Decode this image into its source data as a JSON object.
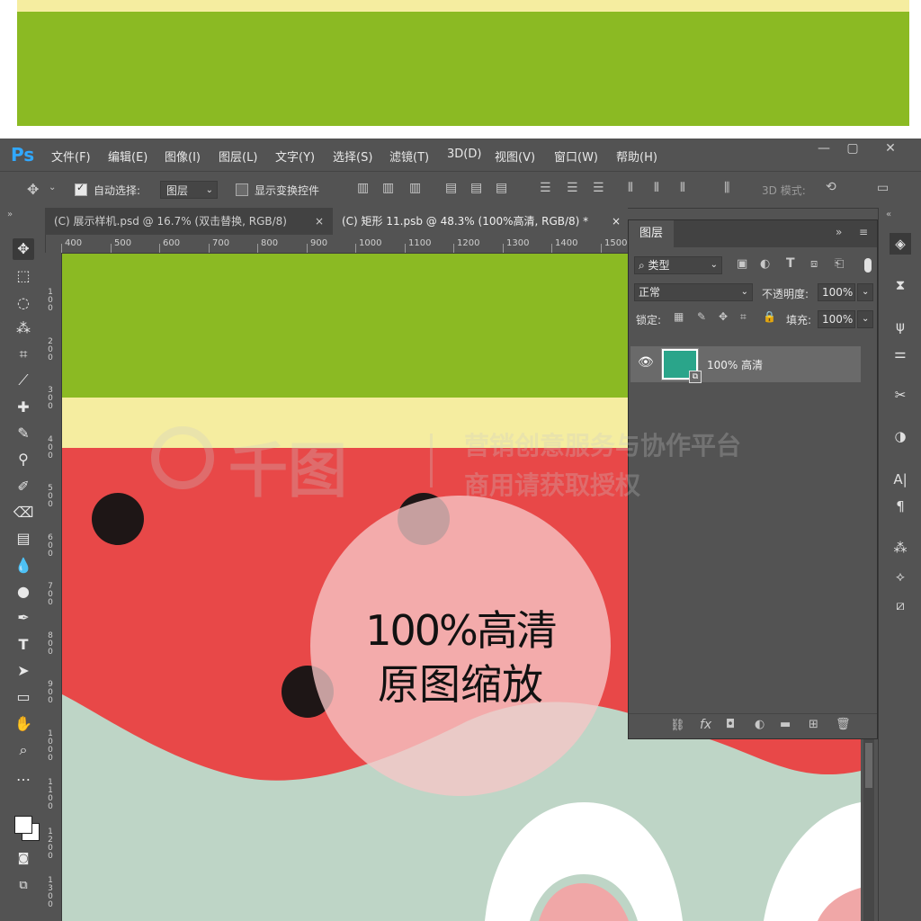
{
  "app": {
    "logo": "Ps",
    "menus": [
      "文件(F)",
      "编辑(E)",
      "图像(I)",
      "图层(L)",
      "文字(Y)",
      "选择(S)",
      "滤镜(T)",
      "3D(D)",
      "视图(V)",
      "窗口(W)",
      "帮助(H)"
    ],
    "window_controls": [
      "—",
      "▢",
      "✕"
    ]
  },
  "options": {
    "auto_select_label": "自动选择:",
    "auto_select_value": "图层",
    "show_transform_label": "显示变换控件",
    "mode_3d_label": "3D 模式:"
  },
  "tabs": [
    {
      "label": "(C) 展示样机.psd @ 16.7% (双击替换, RGB/8)",
      "close": "×"
    },
    {
      "label": "(C) 矩形 11.psb @ 48.3% (100%高清, RGB/8) *",
      "close": "×"
    }
  ],
  "ruler": {
    "h_labels": [
      "400",
      "500",
      "600",
      "700",
      "800",
      "900",
      "1000",
      "1100",
      "1200",
      "1300",
      "1400",
      "1500"
    ],
    "v_labels": [
      "100",
      "200",
      "300",
      "400",
      "500",
      "600",
      "700",
      "800",
      "900",
      "1000",
      "1100",
      "1200",
      "1300"
    ]
  },
  "layers_panel": {
    "title": "图层",
    "filter_kind": "类型",
    "blend_mode": "正常",
    "opacity_label": "不透明度:",
    "opacity_value": "100%",
    "lock_label": "锁定:",
    "fill_label": "填充:",
    "fill_value": "100%",
    "layer_name": "100% 高清",
    "layer_thumb_color": "#2aa58a"
  },
  "watermark": {
    "brand": "千图",
    "line1": "营销创意服务与协作平台",
    "line2": "商用请获取授权"
  },
  "badge": {
    "line1": "100%高清",
    "line2": "原图缩放"
  },
  "colors": {
    "green": "#8bba23",
    "yellow": "#f5eda0",
    "red": "#e84848",
    "mint": "#bed5c6",
    "seed": "#1e1616",
    "ps_blue": "#31a8ff"
  }
}
